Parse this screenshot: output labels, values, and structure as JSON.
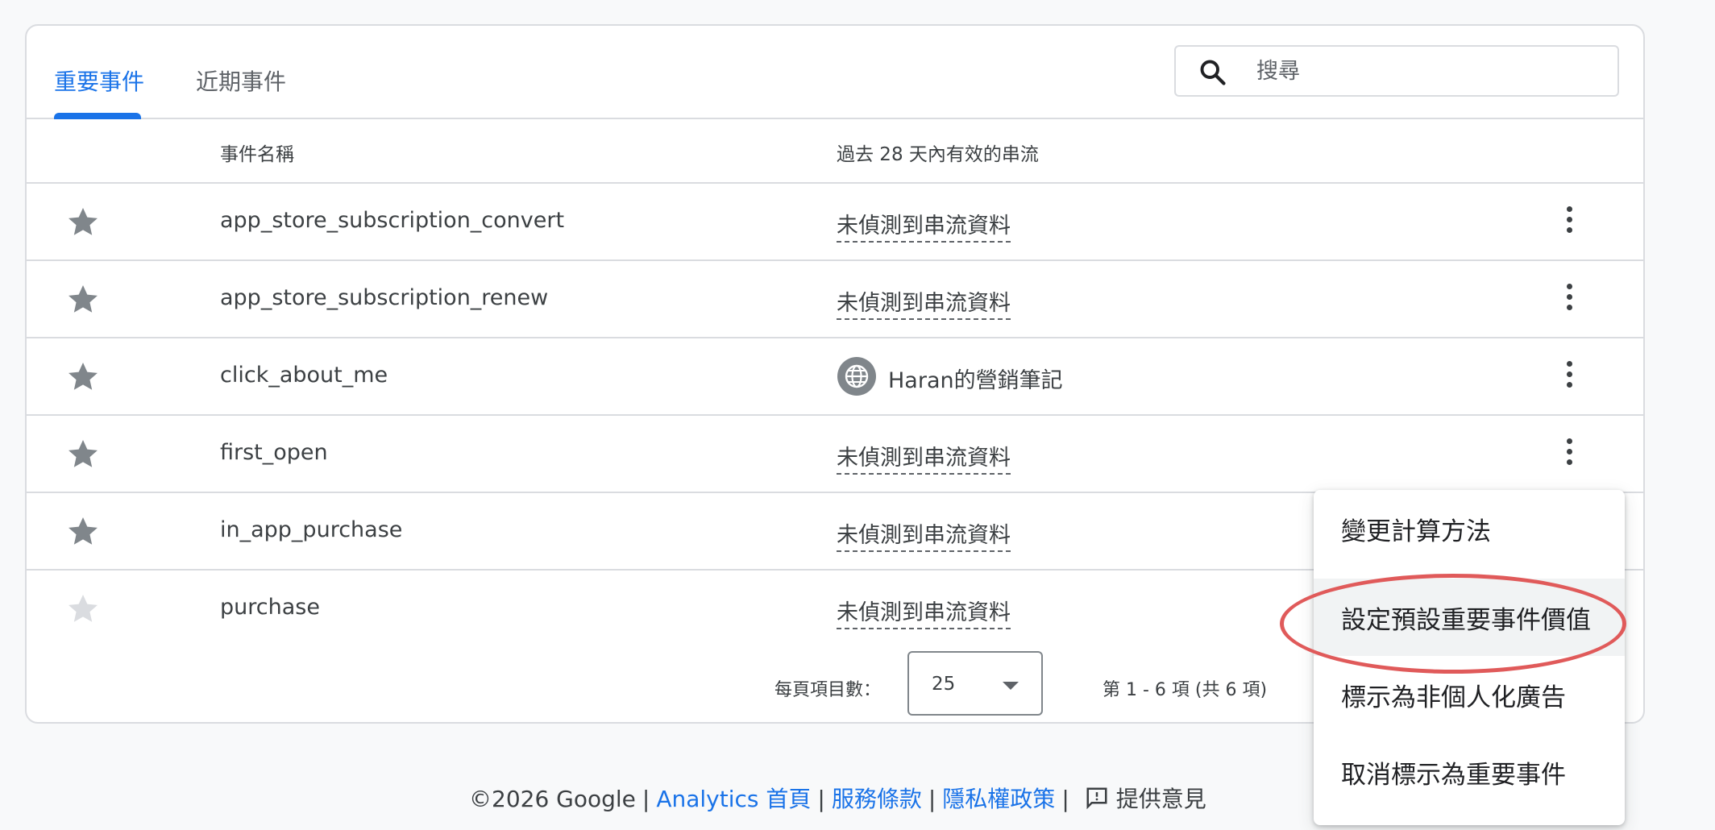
{
  "tabs": [
    {
      "label": "重要事件",
      "active": true
    },
    {
      "label": "近期事件",
      "active": false
    }
  ],
  "search": {
    "placeholder": "搜尋",
    "value": ""
  },
  "table": {
    "headers": {
      "event_name": "事件名稱",
      "streams": "過去 28 天內有效的串流"
    },
    "rows": [
      {
        "name": "app_store_subscription_convert",
        "stream": "未偵測到串流資料",
        "stream_type": "none",
        "starred": true
      },
      {
        "name": "app_store_subscription_renew",
        "stream": "未偵測到串流資料",
        "stream_type": "none",
        "starred": true
      },
      {
        "name": "click_about_me",
        "stream": "Haran的營銷筆記",
        "stream_type": "web",
        "starred": true
      },
      {
        "name": "first_open",
        "stream": "未偵測到串流資料",
        "stream_type": "none",
        "starred": true
      },
      {
        "name": "in_app_purchase",
        "stream": "未偵測到串流資料",
        "stream_type": "none",
        "starred": true
      },
      {
        "name": "purchase",
        "stream": "未偵測到串流資料",
        "stream_type": "none",
        "starred": false
      }
    ]
  },
  "pagination": {
    "label": "每頁項目數：",
    "page_size": "25",
    "range": "第 1 - 6 項 (共 6 項)"
  },
  "menu": {
    "items": [
      "變更計算方法",
      "設定預設重要事件價值",
      "標示為非個人化廣告",
      "取消標示為重要事件"
    ]
  },
  "footer": {
    "copyright": "©2026 Google",
    "links": [
      "Analytics 首頁",
      "服務條款",
      "隱私權政策"
    ],
    "feedback": "提供意見"
  },
  "colors": {
    "accent": "#1a73e8",
    "star_active": "#80868b",
    "star_inactive": "#dadce0",
    "highlight": "#e05a5a"
  },
  "icons": {
    "search": "search-icon",
    "star": "star-icon",
    "globe": "globe-icon",
    "more": "more-vert-icon",
    "feedback": "feedback-icon"
  }
}
